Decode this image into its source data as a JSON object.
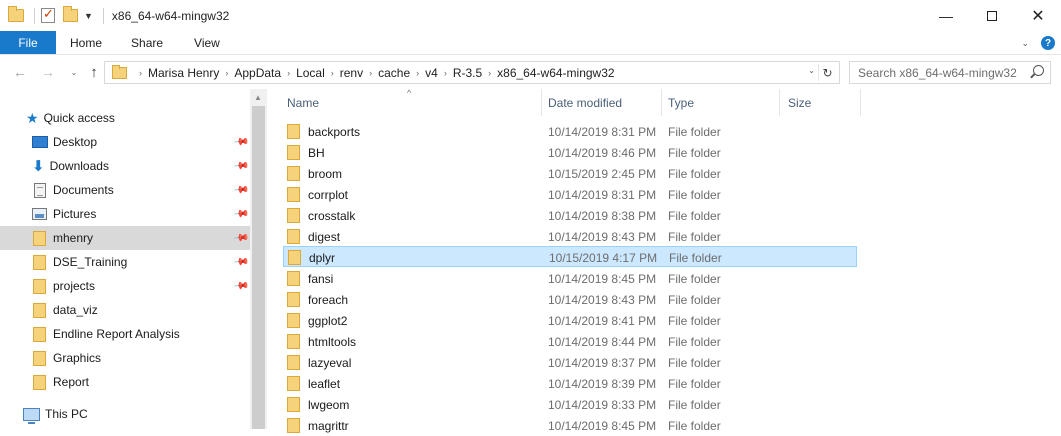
{
  "window": {
    "title": "x86_64-w64-mingw32",
    "minimize_icon": "minimize-icon",
    "maximize_icon": "maximize-icon",
    "close_icon": "close-icon"
  },
  "ribbon": {
    "tabs": [
      "File",
      "Home",
      "Share",
      "View"
    ],
    "accent": "#1979ca"
  },
  "address": {
    "crumbs": [
      "Marisa Henry",
      "AppData",
      "Local",
      "renv",
      "cache",
      "v4",
      "R-3.5",
      "x86_64-w64-mingw32"
    ]
  },
  "search": {
    "placeholder": "Search x86_64-w64-mingw32"
  },
  "navpane": {
    "quick_access": "Quick access",
    "items": [
      {
        "label": "Desktop",
        "icon": "desktop-icon",
        "pinned": true
      },
      {
        "label": "Downloads",
        "icon": "downloads-icon",
        "pinned": true
      },
      {
        "label": "Documents",
        "icon": "documents-icon",
        "pinned": true
      },
      {
        "label": "Pictures",
        "icon": "pictures-icon",
        "pinned": true
      },
      {
        "label": "mhenry",
        "icon": "folder-icon",
        "pinned": true,
        "selected": true
      },
      {
        "label": "DSE_Training",
        "icon": "folder-icon",
        "pinned": true
      },
      {
        "label": "projects",
        "icon": "folder-icon",
        "pinned": true
      },
      {
        "label": "data_viz",
        "icon": "folder-icon",
        "pinned": false
      },
      {
        "label": "Endline Report Analysis",
        "icon": "folder-icon",
        "pinned": false
      },
      {
        "label": "Graphics",
        "icon": "folder-icon",
        "pinned": false
      },
      {
        "label": "Report",
        "icon": "folder-icon",
        "pinned": false
      }
    ],
    "this_pc": "This PC"
  },
  "columns": {
    "name": "Name",
    "date": "Date modified",
    "type": "Type",
    "size": "Size"
  },
  "files": [
    {
      "name": "backports",
      "date": "10/14/2019 8:31 PM",
      "type": "File folder"
    },
    {
      "name": "BH",
      "date": "10/14/2019 8:46 PM",
      "type": "File folder"
    },
    {
      "name": "broom",
      "date": "10/15/2019 2:45 PM",
      "type": "File folder"
    },
    {
      "name": "corrplot",
      "date": "10/14/2019 8:31 PM",
      "type": "File folder"
    },
    {
      "name": "crosstalk",
      "date": "10/14/2019 8:38 PM",
      "type": "File folder"
    },
    {
      "name": "digest",
      "date": "10/14/2019 8:43 PM",
      "type": "File folder"
    },
    {
      "name": "dplyr",
      "date": "10/15/2019 4:17 PM",
      "type": "File folder",
      "selected": true
    },
    {
      "name": "fansi",
      "date": "10/14/2019 8:45 PM",
      "type": "File folder"
    },
    {
      "name": "foreach",
      "date": "10/14/2019 8:43 PM",
      "type": "File folder"
    },
    {
      "name": "ggplot2",
      "date": "10/14/2019 8:41 PM",
      "type": "File folder"
    },
    {
      "name": "htmltools",
      "date": "10/14/2019 8:44 PM",
      "type": "File folder"
    },
    {
      "name": "lazyeval",
      "date": "10/14/2019 8:37 PM",
      "type": "File folder"
    },
    {
      "name": "leaflet",
      "date": "10/14/2019 8:39 PM",
      "type": "File folder"
    },
    {
      "name": "lwgeom",
      "date": "10/14/2019 8:33 PM",
      "type": "File folder"
    },
    {
      "name": "magrittr",
      "date": "10/14/2019 8:45 PM",
      "type": "File folder"
    }
  ]
}
